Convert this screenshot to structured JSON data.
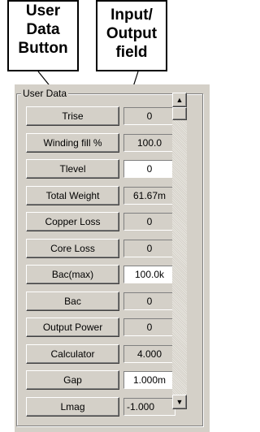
{
  "callouts": {
    "left": [
      "User",
      "Data",
      "Button"
    ],
    "right": [
      "Input/",
      "Output",
      "field"
    ]
  },
  "group_label": "User Data",
  "rows": [
    {
      "button": "Trise",
      "value": "0",
      "editable": false
    },
    {
      "button": "Winding fill %",
      "value": "100.0",
      "editable": false
    },
    {
      "button": "Tlevel",
      "value": "0",
      "editable": true
    },
    {
      "button": "Total Weight",
      "value": "61.67m",
      "editable": false
    },
    {
      "button": "Copper Loss",
      "value": "0",
      "editable": false
    },
    {
      "button": "Core Loss",
      "value": "0",
      "editable": false
    },
    {
      "button": "Bac(max)",
      "value": "100.0k",
      "editable": true
    },
    {
      "button": "Bac",
      "value": "0",
      "editable": false
    },
    {
      "button": "Output Power",
      "value": "0",
      "editable": false
    },
    {
      "button": "Calculator",
      "value": "4.000",
      "editable": false
    },
    {
      "button": "Gap",
      "value": "1.000m",
      "editable": true
    },
    {
      "button": "Lmag",
      "value": "-1.000",
      "editable": false
    }
  ],
  "scrollbar": {
    "up_icon": "scroll-up-arrow-icon",
    "down_icon": "scroll-down-arrow-icon"
  }
}
